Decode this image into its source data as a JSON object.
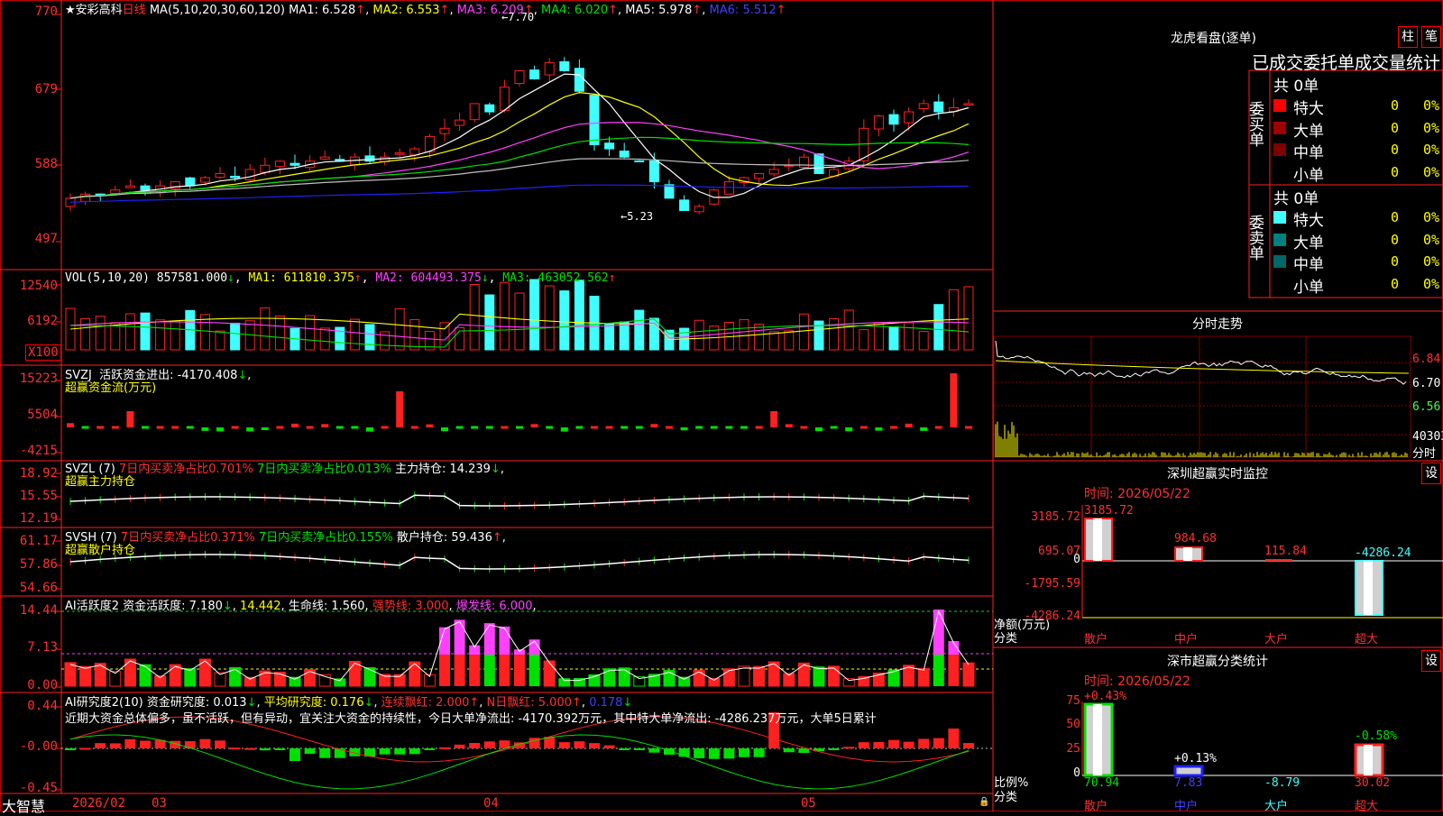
{
  "stock": {
    "name": "安彩高科",
    "period": "日线",
    "star": "★"
  },
  "main_ma": {
    "label": "MA(5,10,20,30,60,120)",
    "ma1": "MA1: 6.528",
    "ma2": "MA2: 6.553",
    "ma3": "MA3: 6.209",
    "ma4": "MA4: 6.020",
    "ma5": "MA5: 5.978",
    "ma6": "MA6: 5.512",
    "arrow": "↑",
    "marker_high": "7.70",
    "marker_low": "5.23"
  },
  "main_axis": [
    "770",
    "679",
    "588",
    "497"
  ],
  "vol": {
    "label": "VOL(5,10,20)",
    "value": "857581.000",
    "ma1": "MA1: 611810.375",
    "ma2": "MA2: 604493.375",
    "ma3": "MA3: 463052.562",
    "axis": [
      "12540",
      "6192"
    ],
    "unit": "X100"
  },
  "svzj": {
    "label": "SVZJ",
    "desc": "活跃资金进出: -4170.408",
    "sub": "超赢资金流(万元)",
    "axis": [
      "15223",
      "5504",
      "-4215"
    ]
  },
  "svzl": {
    "label": "SVZL (7)",
    "a": "7日内买卖净占比0.701%",
    "b": "7日内买卖净占比0.013%",
    "c": "主力持仓: 14.239",
    "sub": "超赢主力持仓",
    "axis": [
      "18.92",
      "15.55",
      "12.19"
    ]
  },
  "svsh": {
    "label": "SVSH (7)",
    "a": "7日内买卖净占比0.371%",
    "b": "7日内买卖净占比0.155%",
    "c": "散户持仓: 59.436",
    "sub": "超赢散户持仓",
    "axis": [
      "61.17",
      "57.86",
      "54.66"
    ]
  },
  "ai1": {
    "label": "AI活跃度2",
    "a": "资金活跃度: 7.180",
    "b": "14.442",
    "c": "生命线: 1.560",
    "d": "强势线: 3.000",
    "e": "爆发线: 6.000",
    "axis": [
      "14.44",
      "7.13",
      "0.00"
    ]
  },
  "ai2": {
    "label": "AI研究度2(10)",
    "a": "资金研究度: 0.013",
    "b": "平均研究度: 0.176",
    "c": "连续飘红: 2.000",
    "d": "N日飘红: 5.000",
    "e": "0.178",
    "axis": [
      "0.44",
      "-0.00",
      "-0.45"
    ],
    "text": "近期大资金总体偏多，虽不活跃，但有异动，宜关注大资金的持续性，今日大单净流出: -4170.392万元，其中特大单净流出: -4286.237万元，大单5日累计"
  },
  "bottom": {
    "brand": "大智慧",
    "date": "2026/02",
    "m3": "03",
    "m4": "04",
    "m5": "05"
  },
  "right": {
    "lhkp": "龙虎看盘(逐单)",
    "btn_zhu": "柱",
    "btn_bi": "笔",
    "deal_title": "已成交委托单成交量统计",
    "buy": {
      "side": "委买单",
      "total": "共 0单",
      "rows": [
        {
          "n": "特大",
          "v": "0",
          "p": "0%",
          "c": "#ff0000"
        },
        {
          "n": "大单",
          "v": "0",
          "p": "0%",
          "c": "#a00000"
        },
        {
          "n": "中单",
          "v": "0",
          "p": "0%",
          "c": "#800000"
        },
        {
          "n": "小单",
          "v": "0",
          "p": "0%",
          "c": "#000000"
        }
      ]
    },
    "sell": {
      "side": "委卖单",
      "total": "共 0单",
      "rows": [
        {
          "n": "特大",
          "v": "0",
          "p": "0%",
          "c": "#40ffff"
        },
        {
          "n": "大单",
          "v": "0",
          "p": "0%",
          "c": "#008080"
        },
        {
          "n": "中单",
          "v": "0",
          "p": "0%",
          "c": "#006868"
        },
        {
          "n": "小单",
          "v": "0",
          "p": "0%",
          "c": "#000000"
        }
      ]
    },
    "fs": {
      "title": "分时走势",
      "axis": [
        "6.84",
        "6.70",
        "6.56",
        "40303"
      ],
      "unit": "分时"
    },
    "sz": {
      "title": "深圳超赢实时监控",
      "btn": "设",
      "time": "时间: 2026/05/22",
      "axis": [
        "3185.72",
        "695.07",
        "0",
        "-1795.59",
        "-4286.24"
      ],
      "labels": [
        "3185.72",
        "984.68",
        "115.84",
        "-4286.24"
      ],
      "unit": "净额(万元)",
      "cat": "分类",
      "cats": [
        "散户",
        "中户",
        "大户",
        "超大"
      ]
    },
    "ss": {
      "title": "深市超赢分类统计",
      "btn": "设",
      "time": "时间: 2026/05/22",
      "axis": [
        "75",
        "50",
        "25",
        "0"
      ],
      "labels": [
        "+0.43%",
        "+0.13%",
        "",
        "-0.58%"
      ],
      "vals": [
        "70.94",
        "7.83",
        "-8.79",
        "30.02"
      ],
      "unit": "比例%",
      "cat": "分类",
      "cats": [
        "散户",
        "中户",
        "大户",
        "超大"
      ]
    }
  }
}
